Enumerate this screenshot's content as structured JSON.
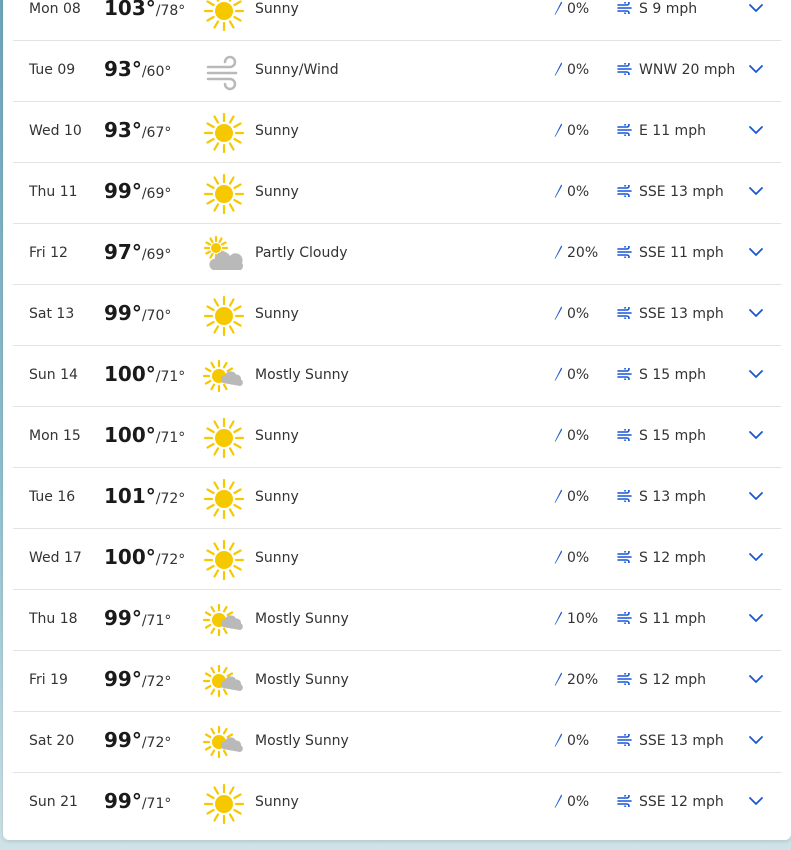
{
  "colors": {
    "accent": "#1a57d6",
    "sun": "#f5c800",
    "cloud": "#b9b9b9"
  },
  "forecast": [
    {
      "day": "Mon 08",
      "hi": "103°",
      "lo": "/78°",
      "icon": "sun-icon",
      "condition": "Sunny",
      "precip": "0%",
      "wind": "S 9 mph"
    },
    {
      "day": "Tue 09",
      "hi": "93°",
      "lo": "/60°",
      "icon": "wind-icon",
      "condition": "Sunny/Wind",
      "precip": "0%",
      "wind": "WNW 20 mph"
    },
    {
      "day": "Wed 10",
      "hi": "93°",
      "lo": "/67°",
      "icon": "sun-icon",
      "condition": "Sunny",
      "precip": "0%",
      "wind": "E 11 mph"
    },
    {
      "day": "Thu 11",
      "hi": "99°",
      "lo": "/69°",
      "icon": "sun-icon",
      "condition": "Sunny",
      "precip": "0%",
      "wind": "SSE 13 mph"
    },
    {
      "day": "Fri 12",
      "hi": "97°",
      "lo": "/69°",
      "icon": "partly-cloudy-icon",
      "condition": "Partly Cloudy",
      "precip": "20%",
      "wind": "SSE 11 mph"
    },
    {
      "day": "Sat 13",
      "hi": "99°",
      "lo": "/70°",
      "icon": "sun-icon",
      "condition": "Sunny",
      "precip": "0%",
      "wind": "SSE 13 mph"
    },
    {
      "day": "Sun 14",
      "hi": "100°",
      "lo": "/71°",
      "icon": "mostly-sunny-icon",
      "condition": "Mostly Sunny",
      "precip": "0%",
      "wind": "S 15 mph"
    },
    {
      "day": "Mon 15",
      "hi": "100°",
      "lo": "/71°",
      "icon": "sun-icon",
      "condition": "Sunny",
      "precip": "0%",
      "wind": "S 15 mph"
    },
    {
      "day": "Tue 16",
      "hi": "101°",
      "lo": "/72°",
      "icon": "sun-icon",
      "condition": "Sunny",
      "precip": "0%",
      "wind": "S 13 mph"
    },
    {
      "day": "Wed 17",
      "hi": "100°",
      "lo": "/72°",
      "icon": "sun-icon",
      "condition": "Sunny",
      "precip": "0%",
      "wind": "S 12 mph"
    },
    {
      "day": "Thu 18",
      "hi": "99°",
      "lo": "/71°",
      "icon": "mostly-sunny-icon",
      "condition": "Mostly Sunny",
      "precip": "10%",
      "wind": "S 11 mph"
    },
    {
      "day": "Fri 19",
      "hi": "99°",
      "lo": "/72°",
      "icon": "mostly-sunny-icon",
      "condition": "Mostly Sunny",
      "precip": "20%",
      "wind": "S 12 mph"
    },
    {
      "day": "Sat 20",
      "hi": "99°",
      "lo": "/72°",
      "icon": "mostly-sunny-icon",
      "condition": "Mostly Sunny",
      "precip": "0%",
      "wind": "SSE 13 mph"
    },
    {
      "day": "Sun 21",
      "hi": "99°",
      "lo": "/71°",
      "icon": "sun-icon",
      "condition": "Sunny",
      "precip": "0%",
      "wind": "SSE 12 mph"
    }
  ]
}
